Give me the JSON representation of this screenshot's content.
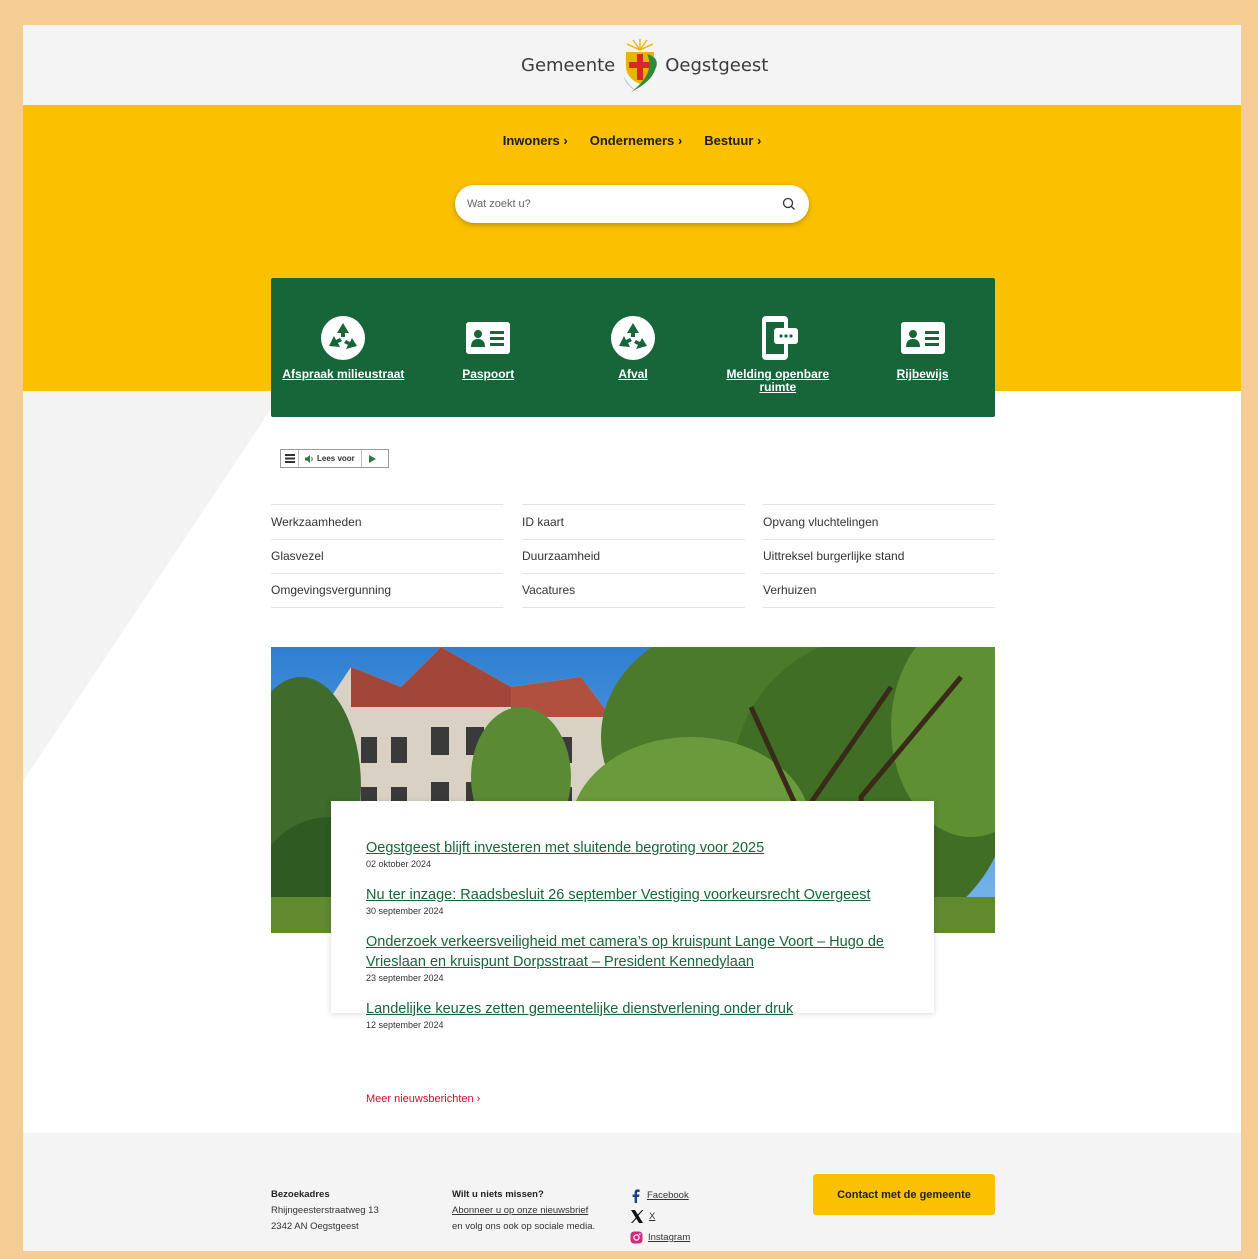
{
  "header": {
    "logo_left": "Gemeente",
    "logo_right": "Oegstgeest"
  },
  "nav": {
    "items": [
      {
        "label": "Inwoners ›"
      },
      {
        "label": "Ondernemers ›"
      },
      {
        "label": "Bestuur ›"
      }
    ]
  },
  "search": {
    "placeholder": "Wat zoekt u?"
  },
  "tiles": [
    {
      "label": "Afspraak milieustraat",
      "icon": "recycle-icon"
    },
    {
      "label": "Paspoort",
      "icon": "id-card-icon"
    },
    {
      "label": "Afval",
      "icon": "recycle-icon"
    },
    {
      "label": "Melding openbare ruimte",
      "icon": "phone-message-icon"
    },
    {
      "label": "Rijbewijs",
      "icon": "id-card-icon"
    }
  ],
  "readspeaker": {
    "label": "Lees voor"
  },
  "links": {
    "col1": [
      "Werkzaamheden",
      "Glasvezel",
      "Omgevingsvergunning"
    ],
    "col2": [
      "ID kaart",
      "Duurzaamheid",
      "Vacatures"
    ],
    "col3": [
      "Opvang vluchtelingen",
      "Uittreksel burgerlijke stand",
      "Verhuizen"
    ]
  },
  "news": {
    "items": [
      {
        "title": "Oegstgeest blijft investeren met sluitende begroting voor 2025",
        "date": "02 oktober 2024"
      },
      {
        "title": "Nu ter inzage: Raadsbesluit 26 september Vestiging voorkeursrecht Overgeest",
        "date": "30 september 2024"
      },
      {
        "title": "Onderzoek verkeersveiligheid met camera’s op kruispunt Lange Voort – Hugo de Vrieslaan en kruispunt Dorpsstraat – President Kennedylaan",
        "date": "23 september 2024"
      },
      {
        "title": "Landelijke keuzes zetten gemeentelijke dienstverlening onder druk",
        "date": "12 september 2024"
      }
    ],
    "more_label": "Meer nieuwsberichten ›"
  },
  "footer": {
    "address_heading": "Bezoekadres",
    "address_line1": "Rhijngeesterstraatweg 13",
    "address_line2": "2342 AN Oegstgeest",
    "newsletter_heading": "Wilt u niets missen?",
    "newsletter_link": "Abonneer u op onze nieuwsbrief",
    "newsletter_text": "en volg ons ook op sociale media.",
    "social": [
      {
        "label": "Facebook",
        "icon": "facebook-icon"
      },
      {
        "label": "X",
        "icon": "x-icon"
      },
      {
        "label": "Instagram",
        "icon": "instagram-icon"
      }
    ],
    "contact_button": "Contact met de gemeente"
  },
  "colors": {
    "yellow": "#fbc100",
    "green": "#17663a",
    "red_link": "#c8102e",
    "frame": "#f5cc93"
  }
}
